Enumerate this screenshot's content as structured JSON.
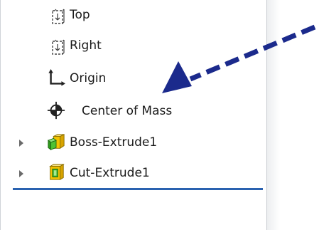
{
  "tree": {
    "items": [
      {
        "label": "Top",
        "icon": "plane-icon"
      },
      {
        "label": "Right",
        "icon": "plane-icon"
      },
      {
        "label": "Origin",
        "icon": "origin-icon"
      },
      {
        "label": "Center of Mass",
        "icon": "center-of-mass-icon"
      },
      {
        "label": "Boss-Extrude1",
        "icon": "boss-extrude-icon",
        "expandable": true
      },
      {
        "label": "Cut-Extrude1",
        "icon": "cut-extrude-icon",
        "expandable": true
      }
    ]
  },
  "colors": {
    "rollback_bar": "#2a62b0",
    "arrow": "#1b2a8c"
  }
}
